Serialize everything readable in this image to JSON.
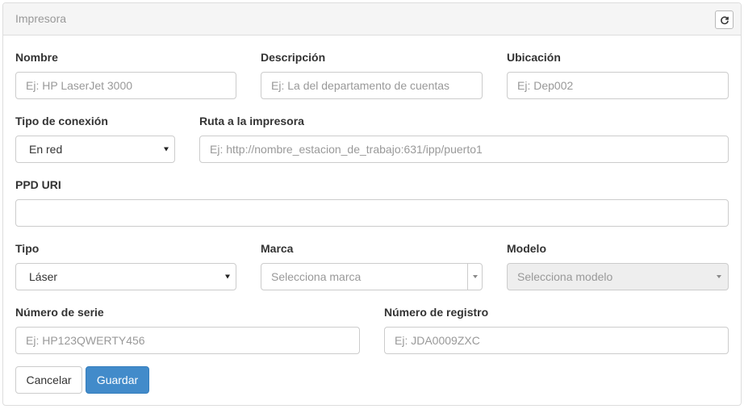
{
  "panel": {
    "title": "Impresora",
    "refresh_icon": "refresh-icon"
  },
  "fields": {
    "nombre": {
      "label": "Nombre",
      "placeholder": "Ej: HP LaserJet 3000",
      "value": ""
    },
    "descripcion": {
      "label": "Descripción",
      "placeholder": "Ej: La del departamento de cuentas",
      "value": ""
    },
    "ubicacion": {
      "label": "Ubicación",
      "placeholder": "Ej: Dep002",
      "value": ""
    },
    "tipo_conexion": {
      "label": "Tipo de conexión",
      "selected": "En red"
    },
    "ruta": {
      "label": "Ruta a la impresora",
      "placeholder": "Ej: http://nombre_estacion_de_trabajo:631/ipp/puerto1",
      "value": ""
    },
    "ppd_uri": {
      "label": "PPD URI",
      "placeholder": "",
      "value": ""
    },
    "tipo": {
      "label": "Tipo",
      "selected": "Láser"
    },
    "marca": {
      "label": "Marca",
      "placeholder": "Selecciona marca"
    },
    "modelo": {
      "label": "Modelo",
      "placeholder": "Selecciona modelo"
    },
    "numero_serie": {
      "label": "Número de serie",
      "placeholder": "Ej: HP123QWERTY456",
      "value": ""
    },
    "numero_registro": {
      "label": "Número de registro",
      "placeholder": "Ej: JDA0009ZXC",
      "value": ""
    }
  },
  "buttons": {
    "cancel_label": "Cancelar",
    "save_label": "Guardar"
  },
  "colors": {
    "primary": "#428bca",
    "panel_heading_bg": "#f5f5f5",
    "border": "#cccccc",
    "disabled_bg": "#eeeeee"
  }
}
